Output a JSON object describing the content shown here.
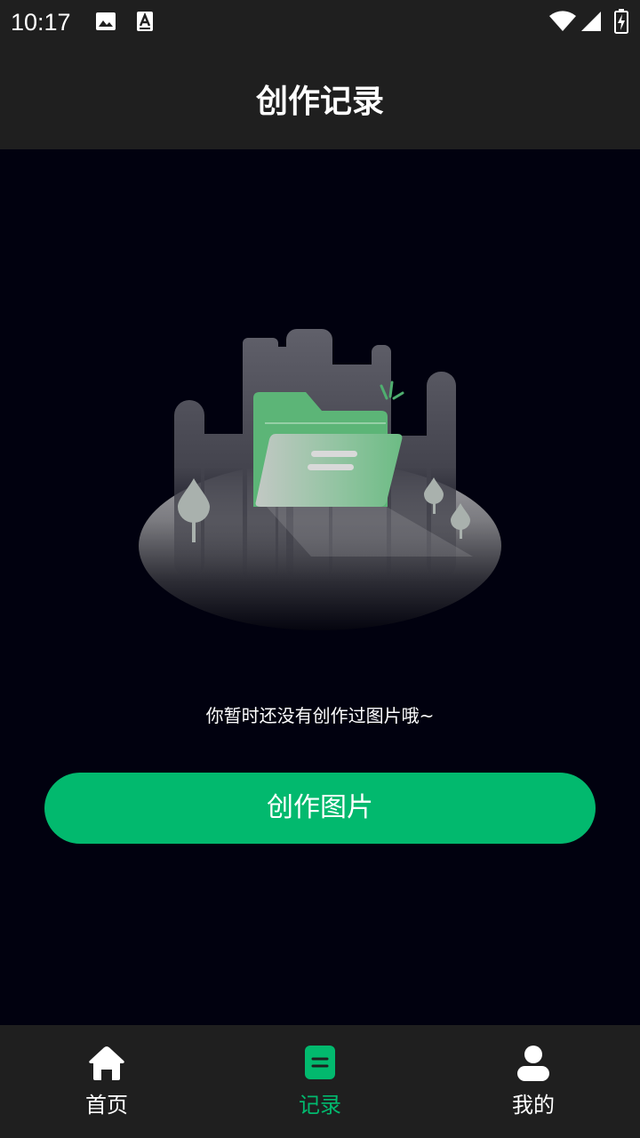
{
  "status_bar": {
    "time": "10:17",
    "icons": [
      "image-notification-icon",
      "a-notification-icon",
      "wifi-icon",
      "cell-signal-icon",
      "battery-charging-icon"
    ]
  },
  "header": {
    "title": "创作记录"
  },
  "empty_state": {
    "illustration": "empty-folder-illustration",
    "message": "你暂时还没有创作过图片哦~",
    "button_label": "创作图片"
  },
  "bottom_nav": {
    "items": [
      {
        "label": "首页",
        "icon": "home-icon",
        "active": false
      },
      {
        "label": "记录",
        "icon": "record-icon",
        "active": true
      },
      {
        "label": "我的",
        "icon": "user-icon",
        "active": false
      }
    ]
  },
  "colors": {
    "accent": "#02b96e",
    "background": "#01010f",
    "bars": "#1f1f1f",
    "text": "#ffffff"
  }
}
